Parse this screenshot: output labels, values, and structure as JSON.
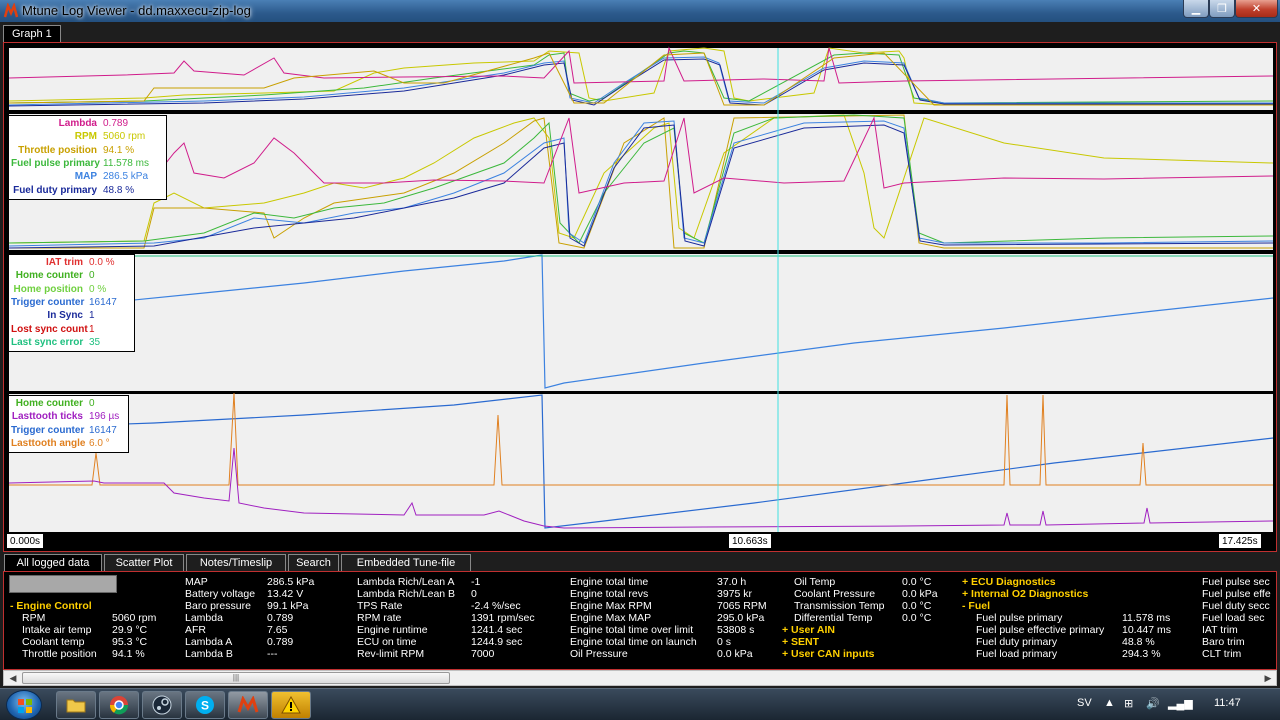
{
  "window": {
    "title": "Mtune Log Viewer - dd.maxxecu-zip-log"
  },
  "graph_tabs": [
    {
      "label": "Graph 1"
    }
  ],
  "graphs": {
    "panel2_legend": [
      {
        "label": "Lambda",
        "value": "0.789",
        "color": "#d01c8b"
      },
      {
        "label": "RPM",
        "value": "5060 rpm",
        "color": "#c8c800"
      },
      {
        "label": "Throttle position",
        "value": "94.1 %",
        "color": "#c8a000"
      },
      {
        "label": "Fuel pulse primary",
        "value": "11.578 ms",
        "color": "#3cb83c"
      },
      {
        "label": "MAP",
        "value": "286.5 kPa",
        "color": "#3c82e0"
      },
      {
        "label": "Fuel duty primary",
        "value": "48.8 %",
        "color": "#1a2a9a"
      }
    ],
    "panel3_legend": [
      {
        "label": "IAT trim",
        "value": "0.0 %",
        "color": "#e03030"
      },
      {
        "label": "Home counter",
        "value": "0",
        "color": "#40b020"
      },
      {
        "label": "Home position",
        "value": "0 %",
        "color": "#70d040"
      },
      {
        "label": "Trigger counter",
        "value": "16147",
        "color": "#2a6ad0"
      },
      {
        "label": "In Sync",
        "value": "1",
        "color": "#1a2a9a"
      },
      {
        "label": "Lost sync count",
        "value": "1",
        "color": "#d01010"
      },
      {
        "label": "Last sync error",
        "value": "35",
        "color": "#20c080"
      }
    ],
    "panel4_legend": [
      {
        "label": "Home counter",
        "value": "0",
        "color": "#40b020"
      },
      {
        "label": "Lasttooth ticks",
        "value": "196 µs",
        "color": "#a020c0"
      },
      {
        "label": "Trigger counter",
        "value": "16147",
        "color": "#2a6ad0"
      },
      {
        "label": "Lasttooth angle",
        "value": "6.0 °",
        "color": "#e08020"
      }
    ],
    "time_start": "0.000s",
    "time_cursor": "10.663s",
    "time_end": "17.425s",
    "colors": {
      "accent_border": "#c03030",
      "cursor": "#40e0e0",
      "section_header": "#ffd000"
    }
  },
  "bottom_tabs": [
    {
      "label": "All logged data",
      "active": true
    },
    {
      "label": "Scatter Plot",
      "active": false
    },
    {
      "label": "Notes/Timeslip",
      "active": false
    },
    {
      "label": "Search",
      "active": false
    },
    {
      "label": "Embedded Tune-file",
      "active": false
    }
  ],
  "data": {
    "col1": {
      "section": "- Engine Control",
      "rows": [
        {
          "label": "RPM",
          "value": "5060 rpm"
        },
        {
          "label": "Intake air temp",
          "value": "29.9 °C"
        },
        {
          "label": "Coolant temp",
          "value": "95.3 °C"
        },
        {
          "label": "Throttle position",
          "value": "94.1 %"
        }
      ]
    },
    "col2": [
      {
        "label": "MAP",
        "value": "286.5 kPa"
      },
      {
        "label": "Battery voltage",
        "value": "13.42 V"
      },
      {
        "label": "Baro pressure",
        "value": "99.1 kPa"
      },
      {
        "label": "Lambda",
        "value": "0.789"
      },
      {
        "label": "AFR",
        "value": "7.65"
      },
      {
        "label": "Lambda A",
        "value": "0.789"
      },
      {
        "label": "Lambda B",
        "value": "---"
      }
    ],
    "col3": [
      {
        "label": "Lambda Rich/Lean A",
        "value": "-1"
      },
      {
        "label": "Lambda Rich/Lean B",
        "value": "0"
      },
      {
        "label": "TPS Rate",
        "value": "-2.4 %/sec"
      },
      {
        "label": "RPM rate",
        "value": "1391 rpm/sec"
      },
      {
        "label": "Engine runtime",
        "value": "1241.4 sec"
      },
      {
        "label": "ECU on time",
        "value": "1244.9 sec"
      },
      {
        "label": "Rev-limit RPM",
        "value": "7000"
      }
    ],
    "col4": [
      {
        "label": "Engine total time",
        "value": "37.0 h"
      },
      {
        "label": "Engine total revs",
        "value": "3975 kr"
      },
      {
        "label": "Engine Max RPM",
        "value": "7065 RPM"
      },
      {
        "label": "Engine Max MAP",
        "value": "295.0 kPa"
      },
      {
        "label": "Engine total time over limit",
        "value": "53808 s"
      },
      {
        "label": "Engine total time on launch",
        "value": "0 s"
      },
      {
        "label": "Oil Pressure",
        "value": "0.0 kPa"
      }
    ],
    "col5": {
      "rows": [
        {
          "label": "Oil Temp",
          "value": "0.0 °C"
        },
        {
          "label": "Coolant Pressure",
          "value": "0.0 kPa"
        },
        {
          "label": "Transmission Temp",
          "value": "0.0 °C"
        },
        {
          "label": "Differential Temp",
          "value": "0.0 °C"
        }
      ],
      "sections": [
        "+ User AIN",
        "+ SENT",
        "+ User CAN inputs"
      ]
    },
    "col6": {
      "sections": [
        "+ ECU Diagnostics",
        "+ Internal O2 Diagnostics",
        "- Fuel"
      ],
      "rows": [
        {
          "label": "Fuel pulse primary",
          "value": "11.578 ms"
        },
        {
          "label": "Fuel pulse effective primary",
          "value": "10.447 ms"
        },
        {
          "label": "Fuel duty primary",
          "value": "48.8 %"
        },
        {
          "label": "Fuel load primary",
          "value": "294.3 %"
        }
      ]
    },
    "col7": [
      "Fuel pulse sec",
      "Fuel pulse effe",
      "Fuel duty secc",
      "Fuel load sec",
      "IAT trim",
      "Baro trim",
      "CLT trim"
    ]
  },
  "taskbar": {
    "lang": "SV",
    "clock": "11:47",
    "apps": [
      "folder-icon",
      "chrome-icon",
      "steam-icon",
      "skype-icon",
      "mtune-icon",
      "warning-icon"
    ]
  }
}
